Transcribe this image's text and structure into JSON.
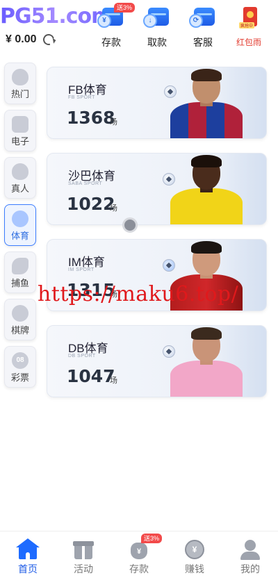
{
  "header": {
    "logo": "PG51.com",
    "balance": "¥ 0.00",
    "actions": [
      {
        "label": "存款",
        "tag": "送3%"
      },
      {
        "label": "取款"
      },
      {
        "label": "客服"
      },
      {
        "label": "红包雨",
        "tag": "疯抢中"
      }
    ]
  },
  "categories": [
    {
      "label": "热门",
      "icon": "flame-icon"
    },
    {
      "label": "电子",
      "icon": "gamepad-icon"
    },
    {
      "label": "真人",
      "icon": "flame-icon"
    },
    {
      "label": "体育",
      "icon": "ball-icon",
      "active": true
    },
    {
      "label": "捕鱼",
      "icon": "fish-icon"
    },
    {
      "label": "棋牌",
      "icon": "cards-icon"
    },
    {
      "label": "彩票",
      "icon": "08"
    }
  ],
  "sports": [
    {
      "name": "FB体育",
      "sub": "FB SPORT",
      "count": "1368",
      "unit": "场"
    },
    {
      "name": "沙巴体育",
      "sub": "SABA SPORT",
      "count": "1022",
      "unit": "场"
    },
    {
      "name": "IM体育",
      "sub": "IM SPORT",
      "count": "1315",
      "unit": "场"
    },
    {
      "name": "DB体育",
      "sub": "DB SPORT",
      "count": "1047",
      "unit": "场"
    }
  ],
  "watermark": "https://maku6.top/",
  "nav": [
    {
      "label": "首页",
      "active": true
    },
    {
      "label": "活动"
    },
    {
      "label": "存款",
      "tag": "送3%"
    },
    {
      "label": "赚钱"
    },
    {
      "label": "我的"
    }
  ],
  "colors": {
    "accent": "#1e5be6",
    "watermark": "#e0191c"
  }
}
